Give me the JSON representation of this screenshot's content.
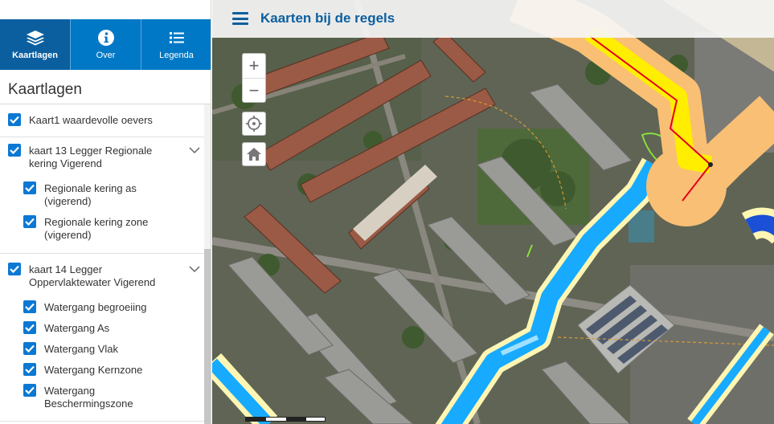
{
  "tabs": [
    {
      "label": "Kaartlagen",
      "icon": "layers-icon"
    },
    {
      "label": "Over",
      "icon": "info-icon"
    },
    {
      "label": "Legenda",
      "icon": "list-icon"
    }
  ],
  "panel": {
    "title": "Kaartlagen"
  },
  "layers": {
    "kaart1": {
      "label": "Kaart1 waardevolle oevers",
      "checked": true
    },
    "kaart13": {
      "label_line1": "kaart 13 Legger Regionale",
      "label_line2": "kering Vigerend",
      "checked": true,
      "sublayers": [
        {
          "line1": "Regionale kering as",
          "line2": "(vigerend)",
          "checked": true
        },
        {
          "line1": "Regionale kering zone",
          "line2": "(vigerend)",
          "checked": true
        }
      ]
    },
    "kaart14": {
      "label_line1": "kaart 14 Legger",
      "label_line2": "Oppervlaktewater Vigerend",
      "checked": true,
      "sublayers": [
        {
          "line1": "Watergang begroeiing",
          "checked": true
        },
        {
          "line1": "Watergang As",
          "checked": true
        },
        {
          "line1": "Watergang Vlak",
          "checked": true
        },
        {
          "line1": "Watergang Kernzone",
          "checked": true
        },
        {
          "line1": "Watergang",
          "line2": "Beschermingszone",
          "checked": true
        }
      ]
    }
  },
  "header": {
    "title": "Kaarten bij de regels",
    "menu_icon": "hamburger-menu-icon"
  },
  "map_controls": {
    "zoom_in": "+",
    "zoom_out": "−",
    "locate_icon": "locate-crosshair-icon",
    "home_icon": "home-icon"
  },
  "colors": {
    "brand": "#0078c6",
    "brand_dark": "#0b5f9f",
    "checkbox": "#0b78d4",
    "kering_zone": "#f9bf74",
    "kering_core": "#ffee00",
    "kering_as": "#e4001b",
    "watergang_vlak": "#17aaff",
    "watergang_zone": "#fff6b3",
    "oevers": "#88e03a"
  }
}
